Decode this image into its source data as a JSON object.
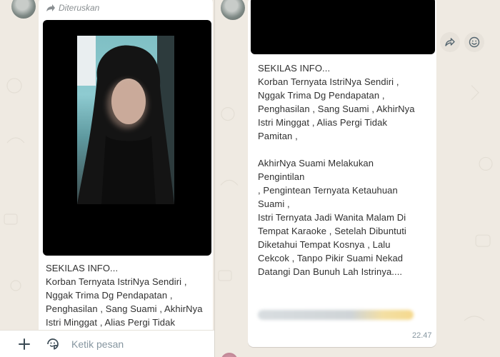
{
  "left": {
    "forwarded_label": "Diteruskan",
    "message_text": "SEKILAS INFO...\nKorban Ternyata IstriNya Sendiri ,\nNggak Trima Dg Pendapatan ,\nPenghasilan , Sang Suami , AkhirNya\nIstri Minggat , Alias Pergi Tidak",
    "compose": {
      "placeholder": "Ketik pesan",
      "add_icon": "plus-icon",
      "sticker_icon": "sticker-icon"
    }
  },
  "right": {
    "message_text": "SEKILAS INFO...\nKorban Ternyata IstriNya Sendiri ,\nNggak Trima Dg Pendapatan ,\nPenghasilan , Sang Suami , AkhirNya\nIstri Minggat , Alias Pergi Tidak\nPamitan ,\n\nAkhirNya Suami Melakukan\nPengintilan\n, Pengintean Ternyata Ketauhuan\nSuami ,\nIstri Ternyata Jadi Wanita Malam Di\nTempat Karaoke ,  Setelah Dibuntuti\nDiketahui Tempat Kosnya , Lalu\nCekcok , Tanpo Pikir Suami Nekad\nDatangi Dan Bunuh Lah Istrinya....",
    "time": "22.47",
    "forward_icon": "forward-icon",
    "emoji_icon": "emoji-icon"
  },
  "colors": {
    "chat_bg": "#efeae2",
    "bubble": "#ffffff",
    "meta_text": "#8696a0"
  }
}
